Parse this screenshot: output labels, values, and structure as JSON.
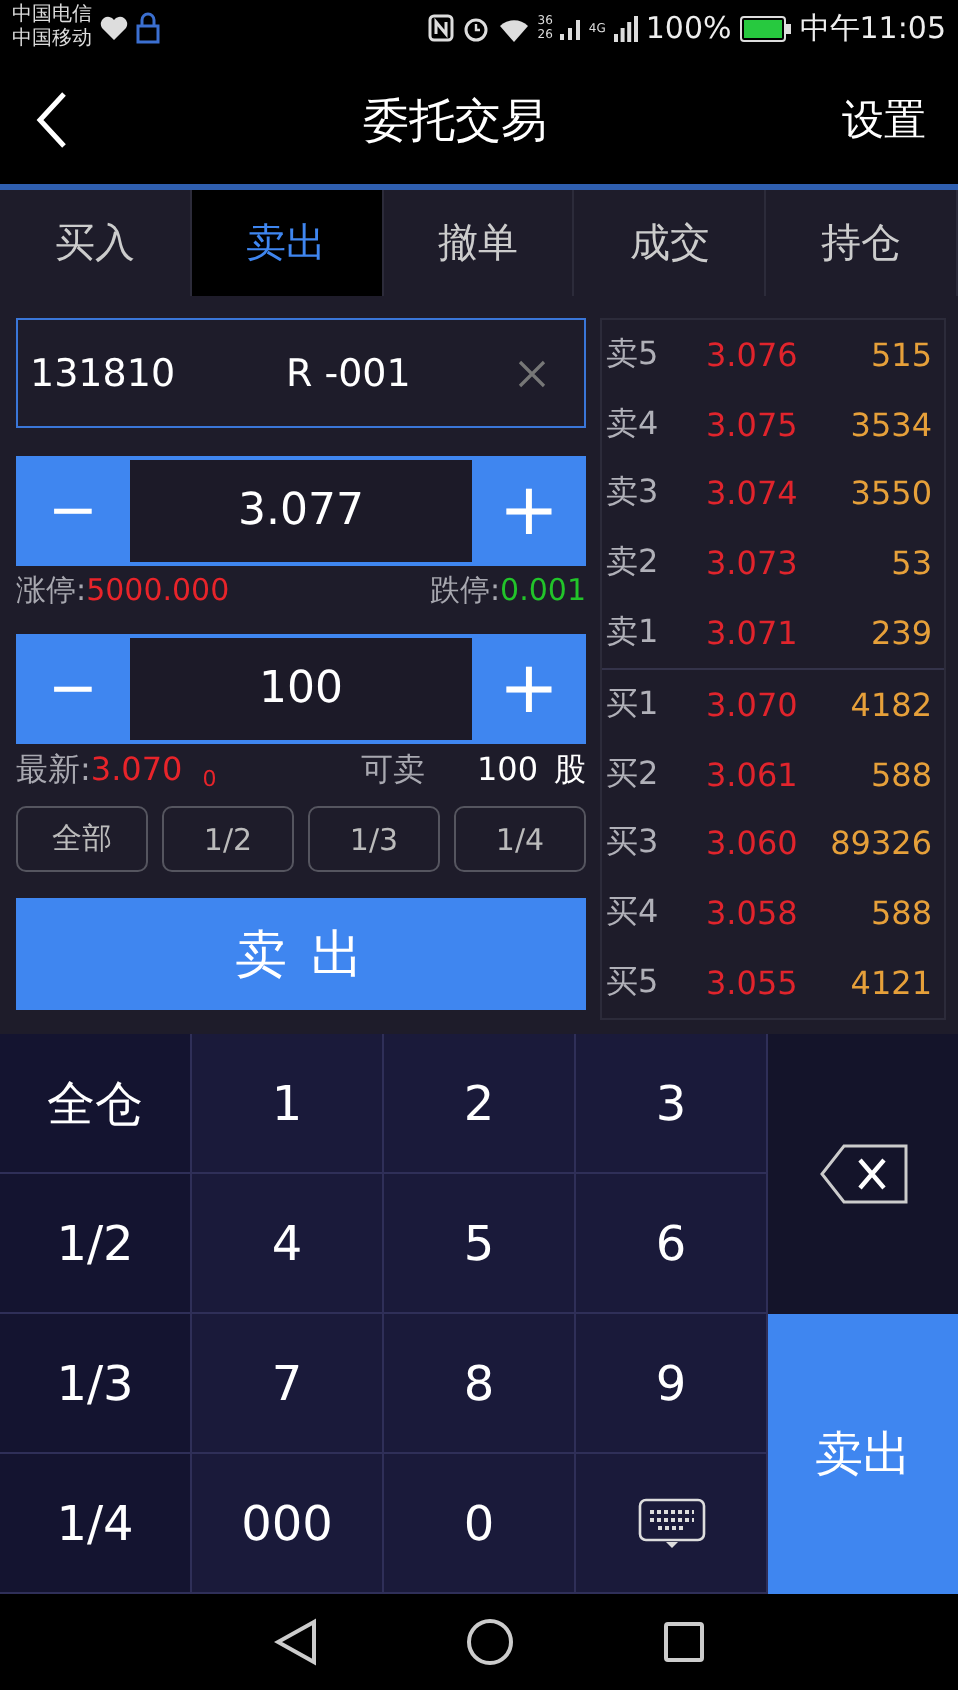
{
  "status_bar": {
    "carriers": [
      "中国电信",
      "中国移动"
    ],
    "network_labels": [
      "36",
      "26",
      "4G"
    ],
    "battery": "100%",
    "time": "中午11:05"
  },
  "header": {
    "title": "委托交易",
    "settings": "设置"
  },
  "tabs": [
    {
      "label": "买入",
      "selected": false
    },
    {
      "label": "卖出",
      "selected": true
    },
    {
      "label": "撤单",
      "selected": false
    },
    {
      "label": "成交",
      "selected": false
    },
    {
      "label": "持仓",
      "selected": false
    }
  ],
  "stock_field": {
    "code": "131810",
    "name": "R -001"
  },
  "price_stepper": {
    "minus": "−",
    "value": "3.077",
    "plus": "+"
  },
  "limits": [
    {
      "label": "涨停:",
      "value": "5000.000",
      "color": "#e8242a"
    },
    {
      "label": "跌停:",
      "value": "0.001",
      "color": "#22c42a"
    }
  ],
  "quantity_stepper": {
    "minus": "−",
    "value": "100",
    "plus": "+"
  },
  "quote": {
    "latest_label": "最新:",
    "latest": "3.070",
    "change": "0",
    "available_label": "可卖",
    "available": "100",
    "unit": "股"
  },
  "fraction_buttons": [
    "全部",
    "1/2",
    "1/3",
    "1/4"
  ],
  "sell_button": "卖 出",
  "order_book": {
    "asks": [
      {
        "label": "卖5",
        "price": "3.076",
        "volume": "515"
      },
      {
        "label": "卖4",
        "price": "3.075",
        "volume": "3534"
      },
      {
        "label": "卖3",
        "price": "3.074",
        "volume": "3550"
      },
      {
        "label": "卖2",
        "price": "3.073",
        "volume": "53"
      },
      {
        "label": "卖1",
        "price": "3.071",
        "volume": "239"
      }
    ],
    "bids": [
      {
        "label": "买1",
        "price": "3.070",
        "volume": "4182"
      },
      {
        "label": "买2",
        "price": "3.061",
        "volume": "588"
      },
      {
        "label": "买3",
        "price": "3.060",
        "volume": "89326"
      },
      {
        "label": "买4",
        "price": "3.058",
        "volume": "588"
      },
      {
        "label": "买5",
        "price": "3.055",
        "volume": "4121"
      }
    ]
  },
  "keypad": {
    "position_keys": [
      "全仓",
      "1/2",
      "1/3",
      "1/4"
    ],
    "digits": [
      "1",
      "2",
      "3",
      "4",
      "5",
      "6",
      "7",
      "8",
      "9",
      "000",
      "0"
    ],
    "action": "卖出"
  }
}
